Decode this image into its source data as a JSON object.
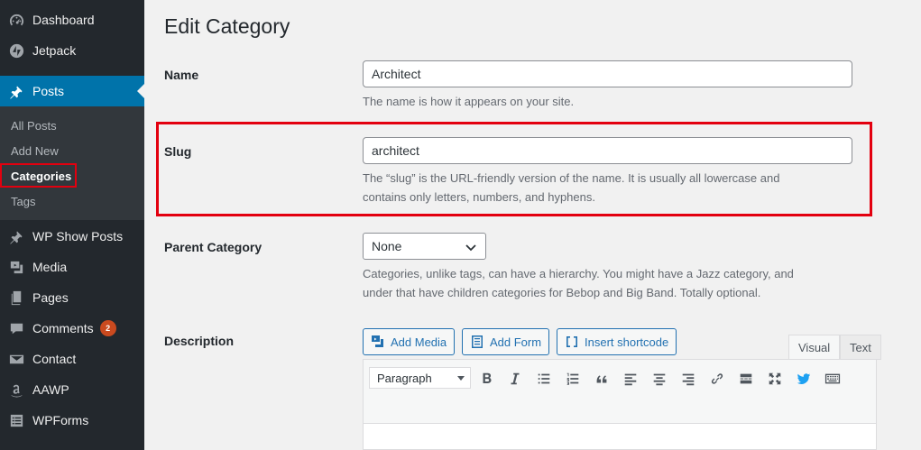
{
  "sidebar": {
    "items": [
      {
        "label": "Dashboard",
        "icon": "dashboard-icon"
      },
      {
        "label": "Jetpack",
        "icon": "jetpack-icon"
      },
      {
        "label": "Posts",
        "icon": "pin-icon"
      },
      {
        "label": "WP Show Posts",
        "icon": "pin-icon"
      },
      {
        "label": "Media",
        "icon": "media-icon"
      },
      {
        "label": "Pages",
        "icon": "pages-icon"
      },
      {
        "label": "Comments",
        "icon": "comments-icon",
        "badge": "2"
      },
      {
        "label": "Contact",
        "icon": "mail-icon"
      },
      {
        "label": "AAWP",
        "icon": "amazon-icon"
      },
      {
        "label": "WPForms",
        "icon": "forms-icon"
      }
    ],
    "submenu": [
      "All Posts",
      "Add New",
      "Categories",
      "Tags"
    ]
  },
  "main": {
    "title": "Edit Category",
    "name": {
      "label": "Name",
      "value": "Architect",
      "help": "The name is how it appears on your site."
    },
    "slug": {
      "label": "Slug",
      "value": "architect",
      "help_line1": "The “slug” is the URL-friendly version of the name. It is usually all lowercase and",
      "help_line2": "contains only letters, numbers, and hyphens."
    },
    "parent": {
      "label": "Parent Category",
      "value": "None",
      "help_line1": "Categories, unlike tags, can have a hierarchy. You might have a Jazz category, and",
      "help_line2": "under that have children categories for Bebop and Big Band. Totally optional."
    },
    "description": {
      "label": "Description",
      "buttons": [
        "Add Media",
        "Add Form",
        "Insert shortcode"
      ],
      "tabs": [
        "Visual",
        "Text"
      ],
      "format": "Paragraph"
    }
  },
  "colors": {
    "sidebar_bg": "#23282d",
    "active": "#0073aa",
    "highlight": "#e3000f",
    "badge": "#ca4a1f"
  }
}
